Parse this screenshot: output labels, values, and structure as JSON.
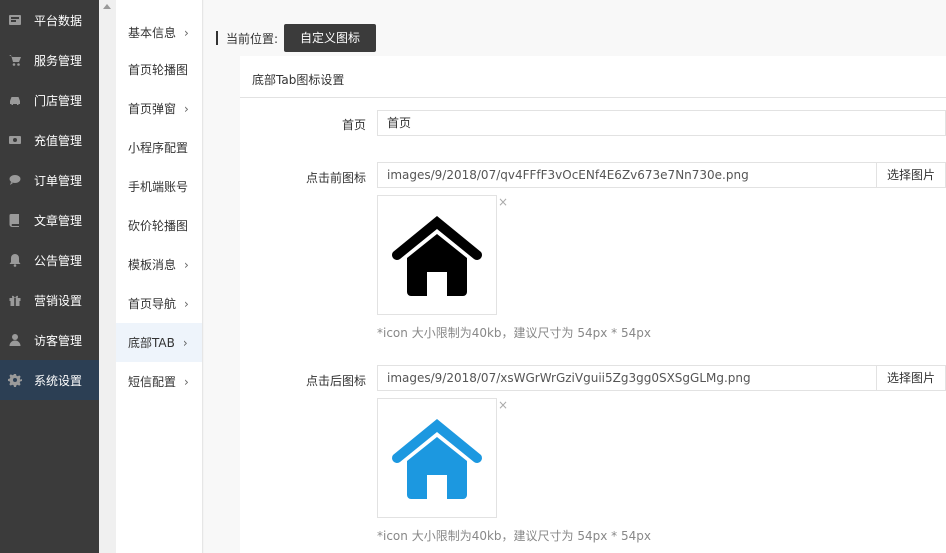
{
  "sidebar": {
    "items": [
      {
        "label": "平台数据",
        "icon": "dashboard-icon"
      },
      {
        "label": "服务管理",
        "icon": "cart-icon"
      },
      {
        "label": "门店管理",
        "icon": "car-icon"
      },
      {
        "label": "充值管理",
        "icon": "money-icon"
      },
      {
        "label": "订单管理",
        "icon": "chat-bubble-icon"
      },
      {
        "label": "文章管理",
        "icon": "book-icon"
      },
      {
        "label": "公告管理",
        "icon": "bell-icon"
      },
      {
        "label": "营销设置",
        "icon": "gift-icon"
      },
      {
        "label": "访客管理",
        "icon": "user-icon"
      },
      {
        "label": "系统设置",
        "icon": "gear-icon",
        "active": true
      }
    ]
  },
  "submenu": {
    "items": [
      {
        "label": "基本信息",
        "chevron": "›"
      },
      {
        "label": "首页轮播图",
        "chevron": ""
      },
      {
        "label": "首页弹窗",
        "chevron": "›"
      },
      {
        "label": "小程序配置",
        "chevron": ""
      },
      {
        "label": "手机端账号",
        "chevron": ""
      },
      {
        "label": "砍价轮播图",
        "chevron": ""
      },
      {
        "label": "模板消息",
        "chevron": "›"
      },
      {
        "label": "首页导航",
        "chevron": "›"
      },
      {
        "label": "底部TAB",
        "chevron": "›",
        "active": true
      },
      {
        "label": "短信配置",
        "chevron": "›"
      }
    ]
  },
  "breadcrumb": {
    "label": "当前位置:",
    "current": "自定义图标"
  },
  "panel": {
    "title": "底部Tab图标设置"
  },
  "form": {
    "name": {
      "label": "首页",
      "value": "首页"
    },
    "before_icon": {
      "label": "点击前图标",
      "path": "images/9/2018/07/qv4FFfF3vOcENf4E6Zv673e7Nn730e.png",
      "button": "选择图片",
      "close": "×",
      "hint": "*icon 大小限制为40kb，建议尺寸为 54px * 54px",
      "color": "#000000"
    },
    "after_icon": {
      "label": "点击后图标",
      "path": "images/9/2018/07/xsWGrWrGziVguii5Zg3gg0SXSgGLMg.png",
      "button": "选择图片",
      "close": "×",
      "hint": "*icon 大小限制为40kb，建议尺寸为 54px * 54px",
      "color": "#1c98e0"
    }
  }
}
